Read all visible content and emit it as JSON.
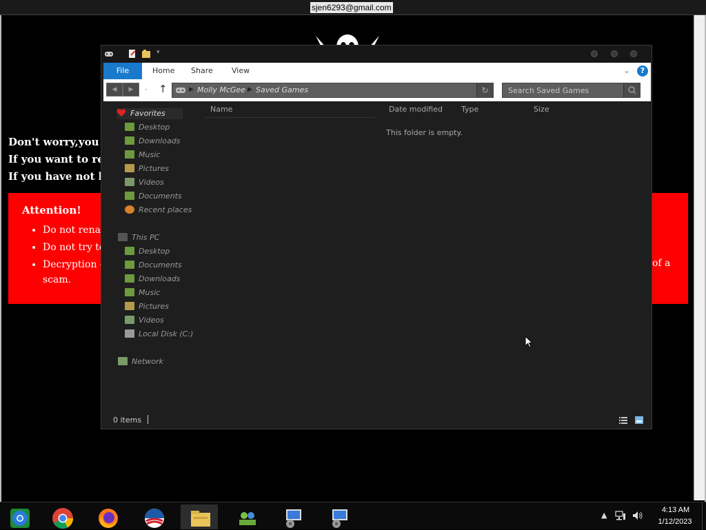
{
  "session": {
    "email": "sjen6293@gmail.com"
  },
  "ransom_page": {
    "lines": [
      "Don't worry,you c",
      "If you want to rest",
      "If you have not be"
    ],
    "attention": {
      "title": "Attention!",
      "items": [
        "Do not renar",
        "Do not try to",
        "Decryption o"
      ],
      "overflow_right": "of a",
      "overflow_scam": "scam."
    },
    "colors": {
      "alert": "#ff0000",
      "background": "#000000"
    }
  },
  "explorer": {
    "ribbon": {
      "file": "File",
      "tabs": [
        "Home",
        "Share",
        "View"
      ],
      "help": "?"
    },
    "address": {
      "crumbs": [
        "Molly McGee",
        "Saved Games"
      ]
    },
    "search": {
      "placeholder": "Search Saved Games"
    },
    "navigation": {
      "favorites": {
        "label": "Favorites",
        "items": [
          "Desktop",
          "Downloads",
          "Music",
          "Pictures",
          "Videos",
          "Documents",
          "Recent places"
        ]
      },
      "this_pc": {
        "label": "This PC",
        "items": [
          "Desktop",
          "Documents",
          "Downloads",
          "Music",
          "Pictures",
          "Videos",
          "Local Disk (C:)"
        ]
      },
      "network": {
        "label": "Network"
      }
    },
    "columns": [
      "Name",
      "Date modified",
      "Type",
      "Size"
    ],
    "empty_message": "This folder is empty.",
    "status": {
      "item_count": "0 items"
    },
    "colors": {
      "accent": "#1979ca",
      "window_bg": "#1e1e1e"
    }
  },
  "taskbar": {
    "apps": [
      "chrome-canary-icon",
      "chrome-icon",
      "firefox-icon",
      "obama-logo-icon",
      "file-explorer-icon",
      "network-users-icon",
      "remote-desktop-icon",
      "remote-desktop-icon-2"
    ],
    "clock": {
      "time": "4:13 AM",
      "date": "1/12/2023"
    }
  }
}
